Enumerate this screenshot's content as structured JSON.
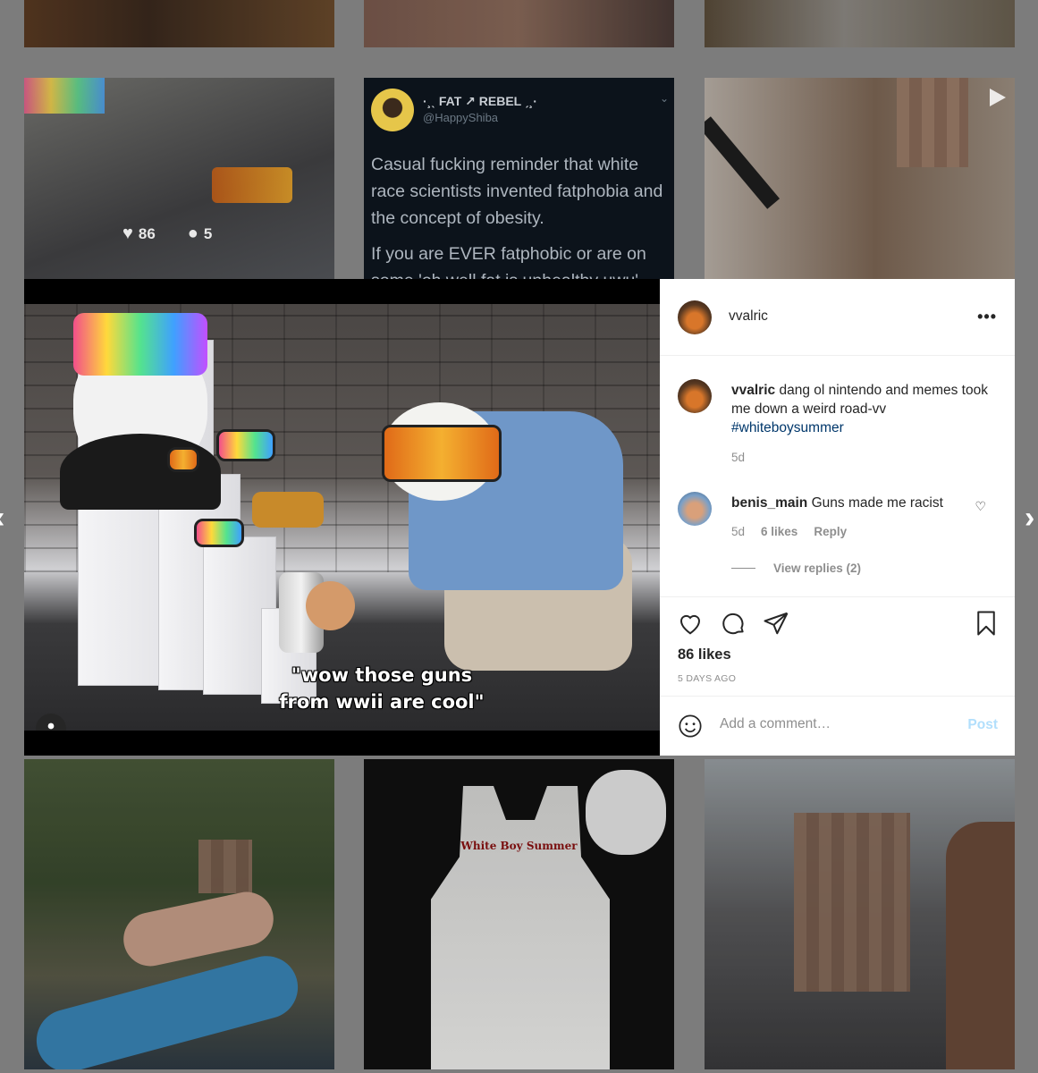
{
  "grid": {
    "r1a_stats": {
      "likes": "86",
      "comments": "5"
    },
    "tweet": {
      "name": "·¸ˎ FAT ↗ REBEL ˏ¸·",
      "handle": "@HappyShiba",
      "p1": "Casual fucking reminder that white race scientists invented fatphobia and the concept of obesity.",
      "p2": "If you are EVER fatphobic or are on some 'oh well fat is unhealthy uwu'"
    },
    "shirt_text": "White Boy Summer"
  },
  "media": {
    "caption": "\"wow those guns from wwii are cool\""
  },
  "post": {
    "username": "vvalric",
    "more": "•••",
    "caption_user": "vvalric",
    "caption_text": "dang ol nintendo and memes took me down a weird road-vv",
    "caption_tag": "#whiteboysummer",
    "caption_time": "5d",
    "comment": {
      "user": "benis_main",
      "text": "Guns made me racist",
      "time": "5d",
      "likes": "6 likes",
      "reply": "Reply"
    },
    "view_replies": "View replies (2)",
    "likes": "86 likes",
    "ago": "5 DAYS AGO",
    "comment_placeholder": "Add a comment…",
    "post_label": "Post"
  },
  "nav": {
    "prev": "‹",
    "next": "›"
  },
  "colors": {
    "link": "#00376b",
    "post_disabled": "#b2dffc",
    "muted": "#8e8e8e"
  }
}
